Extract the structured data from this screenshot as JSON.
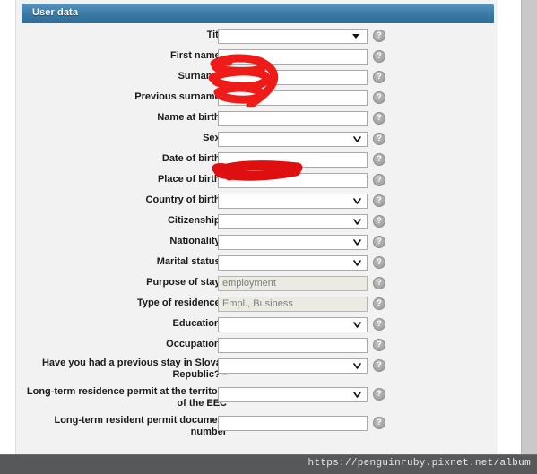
{
  "panel": {
    "header_title": "User data",
    "header_color": "#3e7da9"
  },
  "form": {
    "required_marker": "*",
    "rows": [
      {
        "label": "Title",
        "required": false,
        "type": "select-classic",
        "value": ""
      },
      {
        "label": "First name",
        "required": true,
        "type": "text",
        "value": ""
      },
      {
        "label": "Surname",
        "required": true,
        "type": "text",
        "value": ""
      },
      {
        "label": "Previous surname",
        "required": true,
        "type": "text",
        "value": ""
      },
      {
        "label": "Name at birth",
        "required": true,
        "type": "text",
        "value": ""
      },
      {
        "label": "Sex",
        "required": true,
        "type": "select",
        "value": ""
      },
      {
        "label": "Date of birth",
        "required": true,
        "type": "text",
        "value": ""
      },
      {
        "label": "Place of birth",
        "required": true,
        "type": "text",
        "value": ""
      },
      {
        "label": "Country of birth",
        "required": true,
        "type": "select",
        "value": ""
      },
      {
        "label": "Citizenship",
        "required": true,
        "type": "select",
        "value": ""
      },
      {
        "label": "Nationality",
        "required": true,
        "type": "select",
        "value": ""
      },
      {
        "label": "Marital status",
        "required": true,
        "type": "select",
        "value": ""
      },
      {
        "label": "Purpose of stay",
        "required": true,
        "type": "readonly",
        "value": "employment"
      },
      {
        "label": "Type of residence",
        "required": true,
        "type": "readonly",
        "value": "Empl., Business"
      },
      {
        "label": "Education",
        "required": true,
        "type": "select",
        "value": ""
      },
      {
        "label": "Occupation",
        "required": true,
        "type": "text",
        "value": ""
      },
      {
        "label": "Have you had a previous stay in Slovak Republic?",
        "required": true,
        "type": "select",
        "value": "",
        "tall": true
      },
      {
        "label": "Long-term residence permit at the territory of the EEC",
        "required": false,
        "type": "select",
        "value": "",
        "tall": true
      },
      {
        "label": "Long-term resident permit document number",
        "required": false,
        "type": "text",
        "value": "",
        "tall": true
      }
    ]
  },
  "redactions": [
    {
      "name": "first-name-surname-redaction",
      "color": "#ee1b19"
    },
    {
      "name": "date-of-birth-redaction",
      "color": "#e00f0f"
    }
  ],
  "watermark": {
    "url": "https://penguinruby.pixnet.net/album"
  }
}
